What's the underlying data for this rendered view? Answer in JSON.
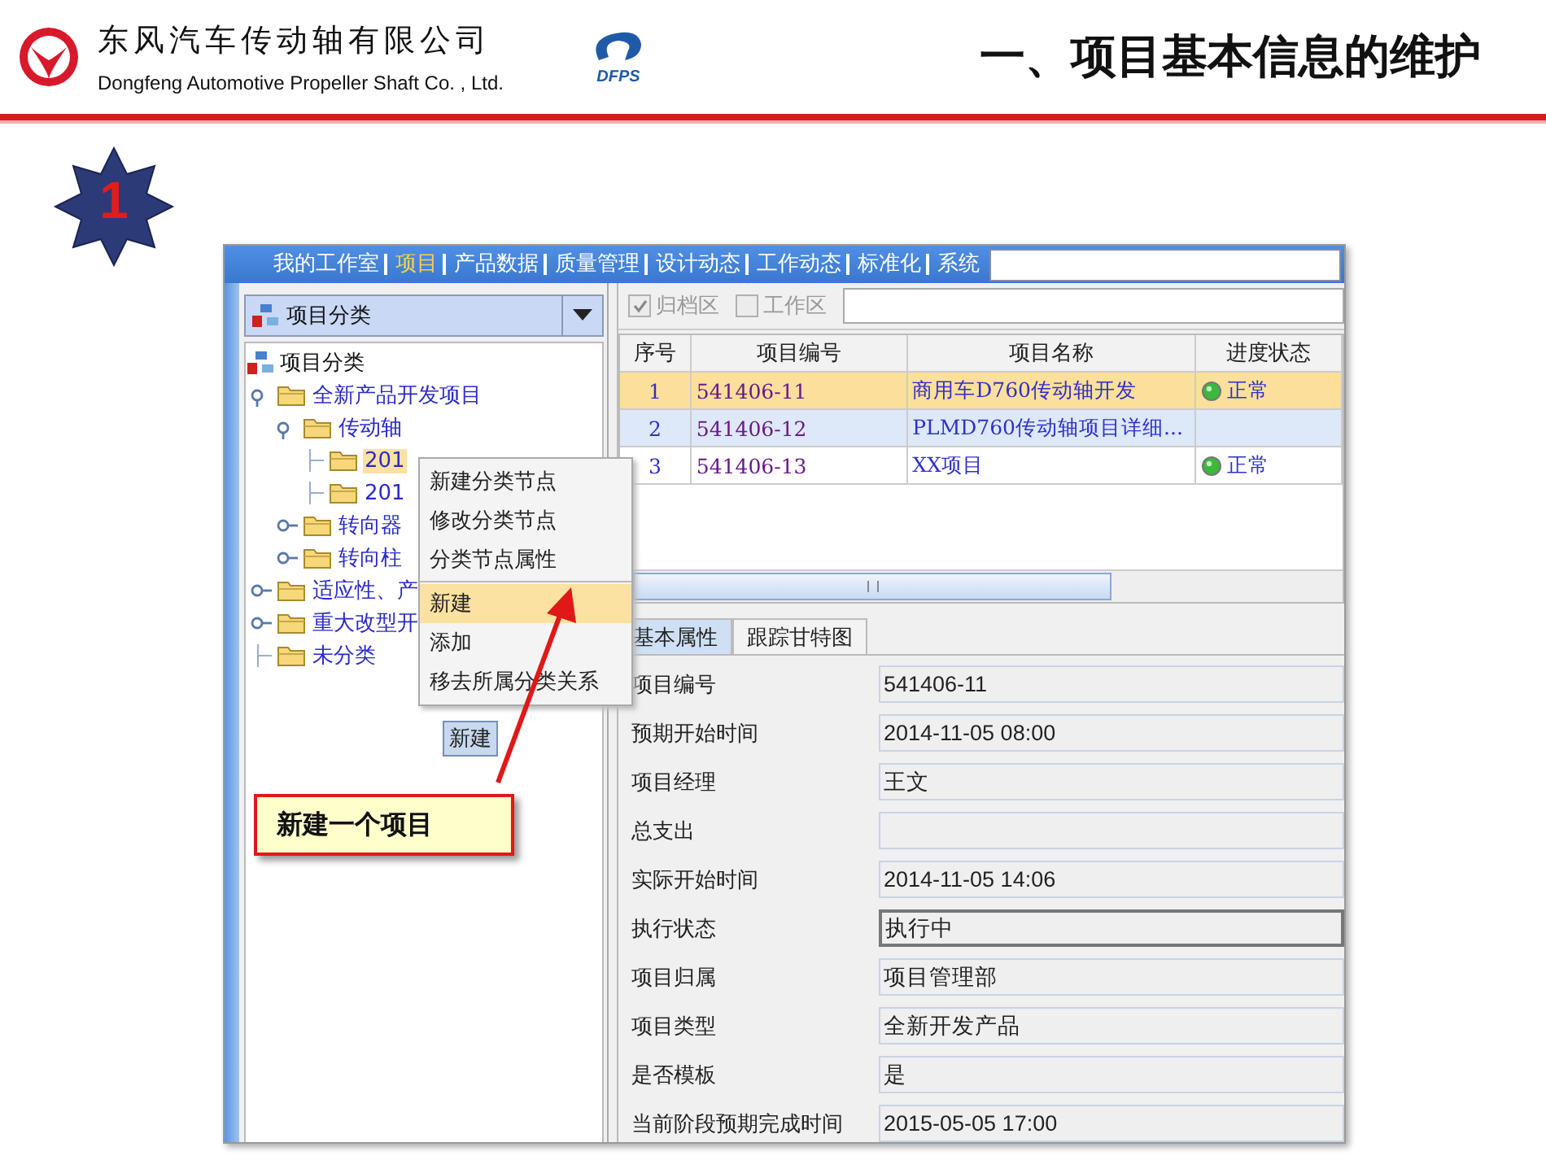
{
  "header": {
    "company_cn": "东风汽车传动轴有限公司",
    "company_en": "Dongfeng Automotive Propeller Shaft Co. , Ltd.",
    "logo_text": "DFPS",
    "title": "一、项目基本信息的维护"
  },
  "step_badge": "1",
  "app": {
    "menu": [
      {
        "label": "我的工作室",
        "selected": false
      },
      {
        "label": "项目",
        "selected": true
      },
      {
        "label": "产品数据",
        "selected": false
      },
      {
        "label": "质量管理",
        "selected": false
      },
      {
        "label": "设计动态",
        "selected": false
      },
      {
        "label": "工作动态",
        "selected": false
      },
      {
        "label": "标准化",
        "selected": false
      },
      {
        "label": "系统",
        "selected": false
      }
    ],
    "category_combo": {
      "value": "项目分类"
    },
    "tree": {
      "label": "项目分类",
      "children": [
        {
          "label": "全新产品开发项目",
          "selected": false,
          "expanded": true,
          "children": [
            {
              "label": "传动轴",
              "selected": false,
              "expanded": true,
              "children": [
                {
                  "label": "201",
                  "selected": true
                },
                {
                  "label": "201",
                  "selected": false
                }
              ]
            },
            {
              "label": "转向器",
              "selected": false,
              "expanded": false
            },
            {
              "label": "转向柱",
              "selected": false,
              "expanded": false
            }
          ]
        },
        {
          "label": "适应性、产",
          "selected": false,
          "expanded": false
        },
        {
          "label": "重大改型开",
          "selected": false,
          "expanded": false
        },
        {
          "label": "未分类",
          "selected": false
        }
      ]
    },
    "context_menu": [
      {
        "kind": "item",
        "label": "新建分类节点",
        "selected": false
      },
      {
        "kind": "item",
        "label": "修改分类节点",
        "selected": false
      },
      {
        "kind": "item",
        "label": "分类节点属性",
        "selected": false
      },
      {
        "kind": "separator"
      },
      {
        "kind": "item",
        "label": "新建",
        "selected": true
      },
      {
        "kind": "item",
        "label": "添加",
        "selected": false
      },
      {
        "kind": "item",
        "label": "移去所属分类关系",
        "selected": false
      }
    ],
    "tooltip": "新建",
    "callout": "新建一个项目",
    "filters": [
      {
        "label": "归档区",
        "checked": true,
        "disabled": true
      },
      {
        "label": "工作区",
        "checked": false,
        "disabled": true
      }
    ],
    "table": {
      "columns": [
        "序号",
        "项目编号",
        "项目名称",
        "进度状态"
      ],
      "rows": [
        {
          "cells": [
            "1",
            "541406-11",
            "商用车D760传动轴开发"
          ],
          "status": "正常",
          "selected": true,
          "hover": false
        },
        {
          "cells": [
            "2",
            "541406-12",
            "PLMD760传动轴项目详细..."
          ],
          "selected": false,
          "hover": true
        },
        {
          "cells": [
            "3",
            "541406-13",
            "XX项目"
          ],
          "status": "正常",
          "selected": false,
          "hover": false
        }
      ]
    },
    "detail_tabs": [
      {
        "label": "基本属性",
        "selected": true
      },
      {
        "label": "跟踪甘特图",
        "selected": false
      }
    ],
    "fields": [
      {
        "label": "项目编号",
        "value": "541406-11",
        "focused": false
      },
      {
        "label": "预期开始时间",
        "value": "2014-11-05 08:00",
        "focused": false
      },
      {
        "label": "项目经理",
        "value": "王文",
        "focused": false
      },
      {
        "label": "总支出",
        "focused": false
      },
      {
        "label": "实际开始时间",
        "value": "2014-11-05 14:06",
        "focused": false
      },
      {
        "label": "执行状态",
        "value": "执行中",
        "focused": true
      },
      {
        "label": "项目归属",
        "value": "项目管理部",
        "focused": false
      },
      {
        "label": "项目类型",
        "value": "全新开发产品",
        "focused": false
      },
      {
        "label": "是否模板",
        "value": "是",
        "focused": false
      },
      {
        "label": "当前阶段预期完成时间",
        "value": "2015-05-05 17:00",
        "focused": false
      }
    ]
  }
}
